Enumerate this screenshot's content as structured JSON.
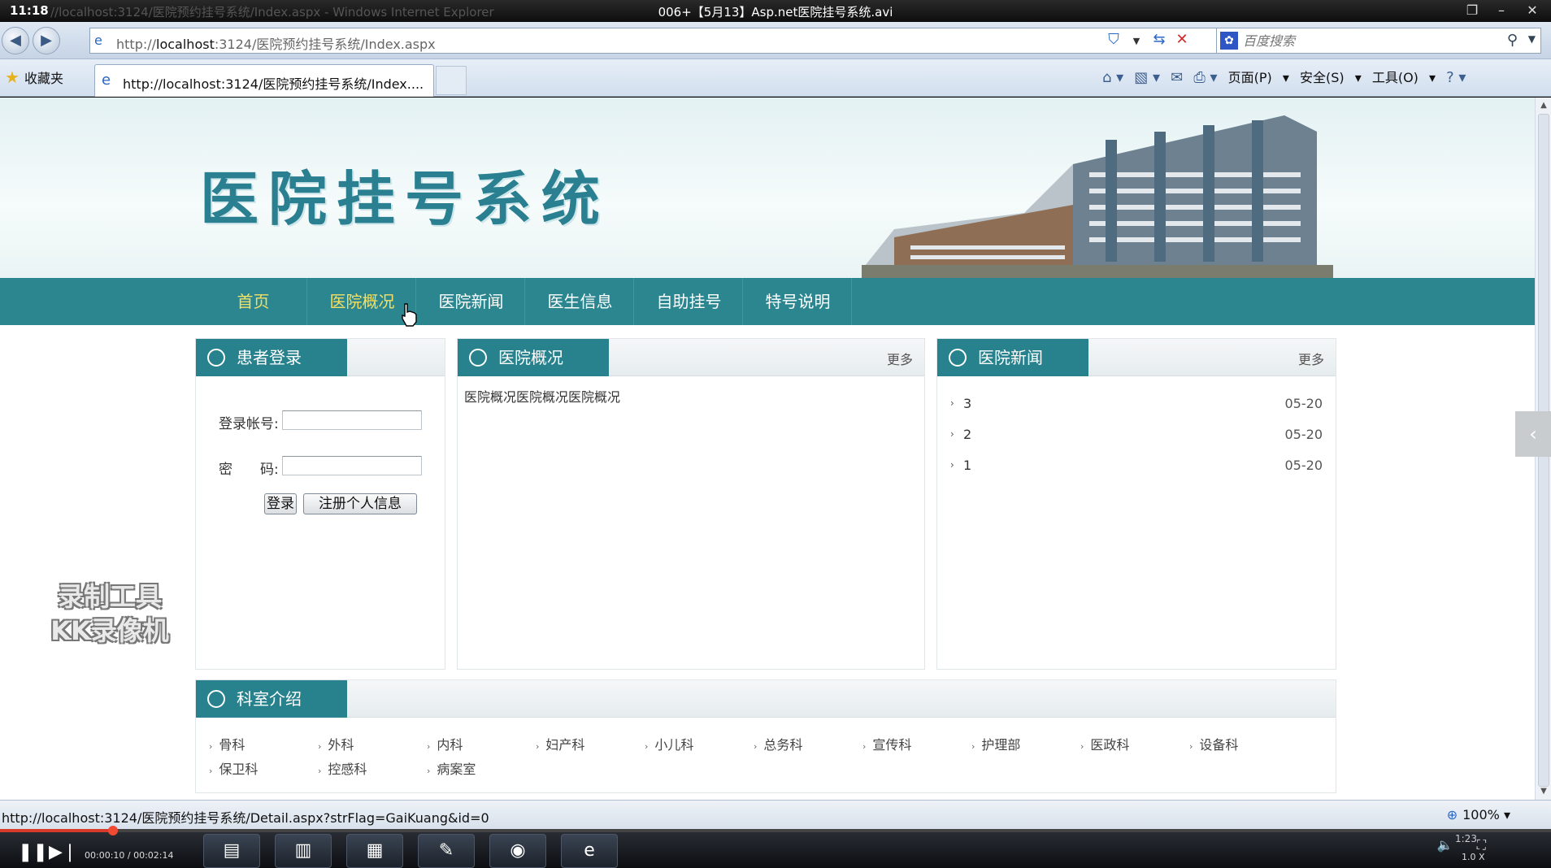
{
  "player": {
    "time": "11:18",
    "ghost_title": "//localhost:3124/医院预约挂号系统/Index.aspx - Windows Internet Explorer",
    "file_name": "006+【5月13】Asp.net医院挂号系统.avi",
    "play_time": "00:00:10 / 00:02:14",
    "speed": "1.0 X",
    "clock": "1:23",
    "progress_fraction": 0.073
  },
  "browser": {
    "address_prefix": "http://",
    "address_host": "localhost",
    "address_rest": ":3124/医院预约挂号系统/Index.aspx",
    "search_placeholder": "百度搜索",
    "favorites_label": "收藏夹",
    "tab_title": "http://localhost:3124/医院预约挂号系统/Index....",
    "commands": {
      "page": "页面(P)",
      "safety": "安全(S)",
      "tools": "工具(O)"
    },
    "status_url": "http://localhost:3124/医院预约挂号系统/Detail.aspx?strFlag=GaiKuang&id=0",
    "zoom": "100%"
  },
  "site": {
    "title": "医院挂号系统",
    "nav": [
      {
        "label": "首页",
        "active": true
      },
      {
        "label": "医院概况",
        "active": true
      },
      {
        "label": "医院新闻",
        "active": false
      },
      {
        "label": "医生信息",
        "active": false
      },
      {
        "label": "自助挂号",
        "active": false
      },
      {
        "label": "特号说明",
        "active": false
      }
    ],
    "login": {
      "title": "患者登录",
      "account_label": "登录帐号:",
      "password_label": "密　　码:",
      "login_button": "登录",
      "register_button": "注册个人信息"
    },
    "overview": {
      "title": "医院概况",
      "more": "更多",
      "text": "医院概况医院概况医院概况"
    },
    "news": {
      "title": "医院新闻",
      "more": "更多",
      "items": [
        {
          "title": "3",
          "date": "05-20"
        },
        {
          "title": "2",
          "date": "05-20"
        },
        {
          "title": "1",
          "date": "05-20"
        }
      ]
    },
    "departments": {
      "title": "科室介绍",
      "items": [
        "骨科",
        "外科",
        "内科",
        "妇产科",
        "小儿科",
        "总务科",
        "宣传科",
        "护理部",
        "医政科",
        "设备科",
        "保卫科",
        "控感科",
        "病案室"
      ]
    }
  },
  "watermark": {
    "line1": "录制工具",
    "line2": "KK录像机"
  },
  "colors": {
    "nav_bg": "#2b8690",
    "nav_active": "#f4e063",
    "panel_title_bg": "#27828d",
    "title_text": "#2a7f90"
  }
}
